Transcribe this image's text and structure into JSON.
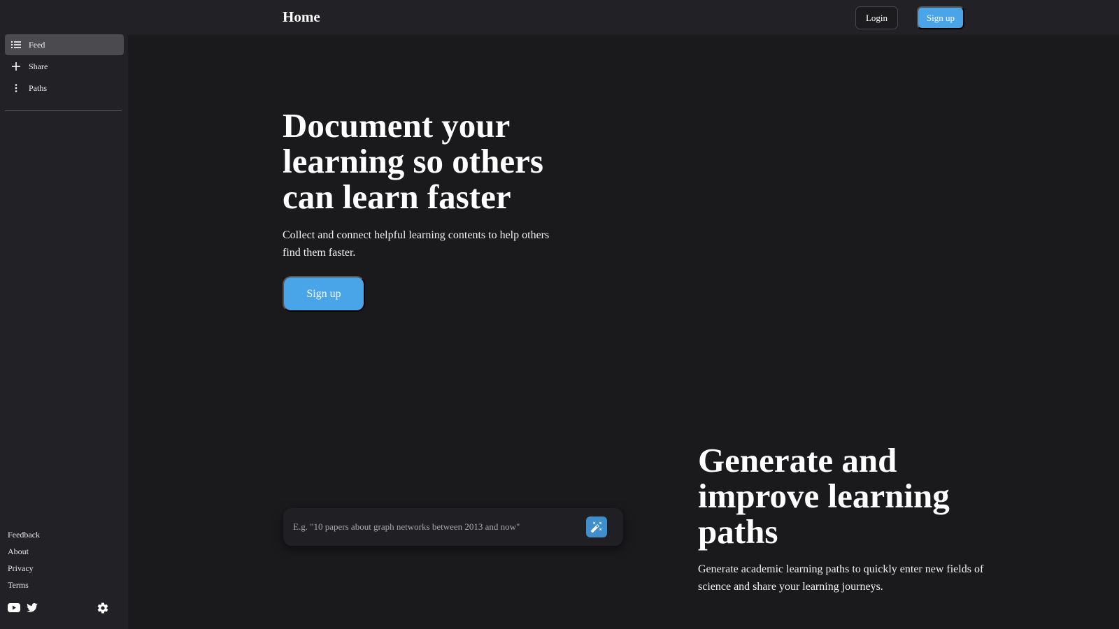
{
  "header": {
    "title": "Home",
    "login_label": "Login",
    "signup_label": "Sign up"
  },
  "sidebar": {
    "items": [
      {
        "label": "Feed",
        "icon": "list-icon",
        "active": true
      },
      {
        "label": "Share",
        "icon": "plus-icon",
        "active": false
      },
      {
        "label": "Paths",
        "icon": "vertical-dots-icon",
        "active": false
      }
    ],
    "footer_links": [
      "Feedback",
      "About",
      "Privacy",
      "Terms"
    ],
    "social_icons": [
      "youtube-icon",
      "twitter-icon"
    ],
    "settings_icon": "gear-icon"
  },
  "hero": {
    "title": "Document your learning so others can learn faster",
    "subtitle": "Collect and connect helpful learning contents to help others find them faster.",
    "cta_label": "Sign up"
  },
  "generator": {
    "placeholder": "E.g. \"10 papers about graph networks between 2013 and now\"",
    "value": "",
    "button_icon": "magic-wand-icon"
  },
  "section2": {
    "title": "Generate and improve learning paths",
    "subtitle": "Generate academic learning paths to quickly enter new fields of science and share your learning journeys."
  },
  "colors": {
    "background": "#1a1a1d",
    "panel": "#222226",
    "accent": "#4aa5e8",
    "active_item": "#4a4a4f"
  }
}
